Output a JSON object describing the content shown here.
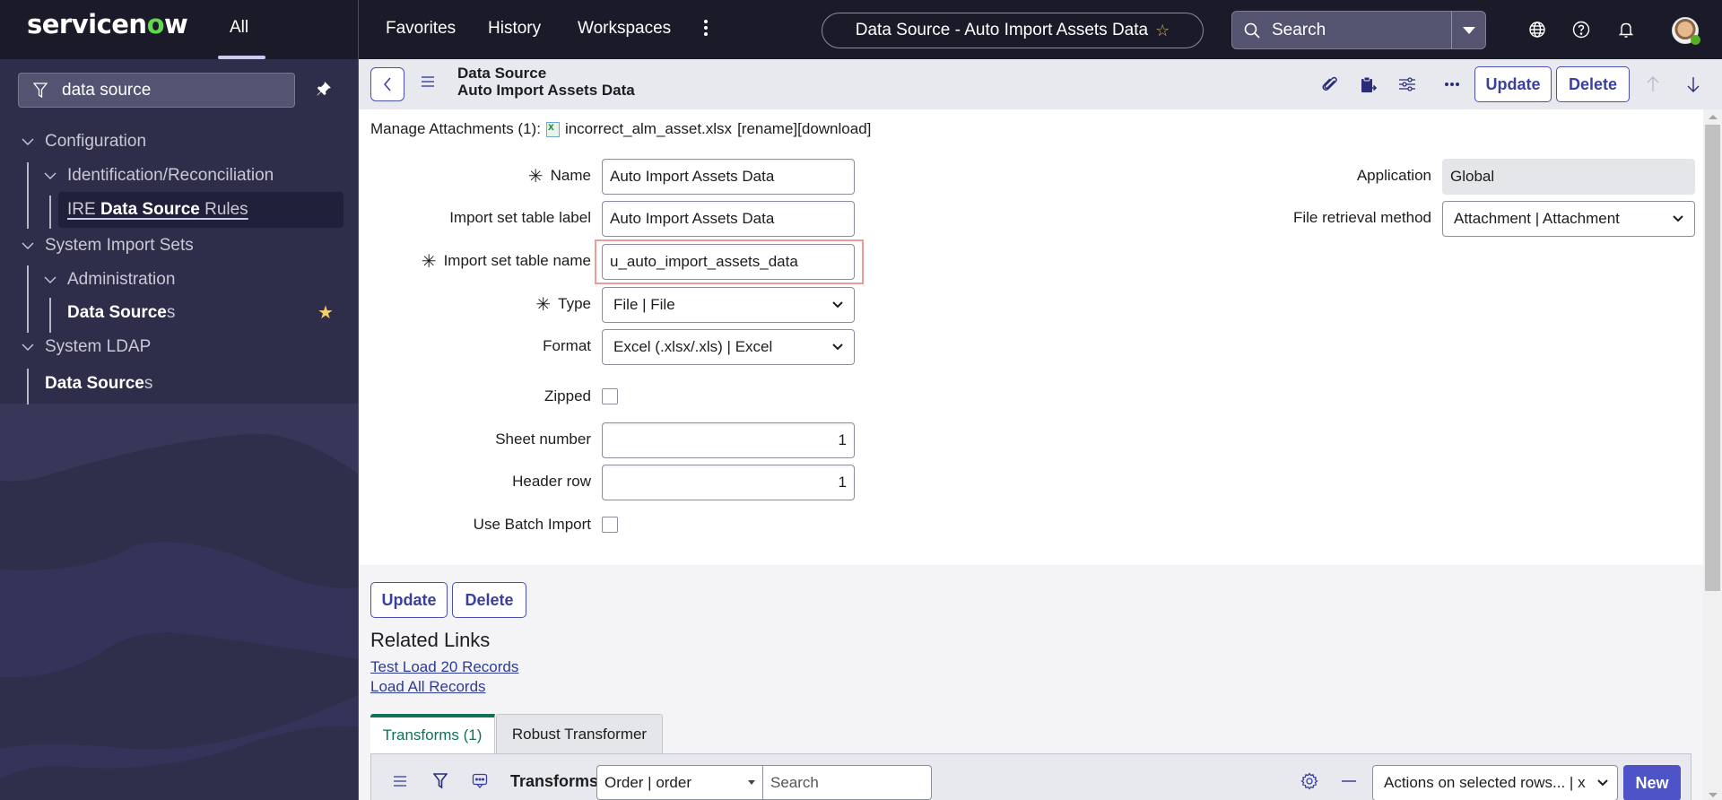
{
  "topbar": {
    "logo_main": "servicen",
    "logo_o": "o",
    "logo_end": "w",
    "all_tab": "All",
    "nav": [
      "Favorites",
      "History",
      "Workspaces"
    ],
    "more_icon": "vertical-ellipsis-icon",
    "record_title": "Data Source - Auto Import Assets Data",
    "search_placeholder": "Search",
    "icons": [
      "globe-icon",
      "help-icon",
      "bell-icon",
      "user-avatar"
    ]
  },
  "sidebar": {
    "filter_value": "data source",
    "items": [
      {
        "label": "Configuration",
        "level": 0,
        "expanded": true
      },
      {
        "label": "Identification/Reconciliation",
        "level": 1,
        "expanded": true
      },
      {
        "label_pre": "IRE ",
        "label_match": "Data Source",
        "label_post": " Rules",
        "level": 2,
        "active": true
      },
      {
        "label": "System Import Sets",
        "level": 0,
        "expanded": true
      },
      {
        "label": "Administration",
        "level": 1,
        "expanded": true
      },
      {
        "label_match": "Data Source",
        "label_post": "s",
        "level": 2,
        "favorite": true
      },
      {
        "label": "System LDAP",
        "level": 0,
        "expanded": true
      },
      {
        "label_match": "Data Source",
        "label_post": "s",
        "level": 1
      }
    ]
  },
  "form_header": {
    "record_type": "Data Source",
    "record_name": "Auto Import Assets Data",
    "update_label": "Update",
    "delete_label": "Delete"
  },
  "attachments": {
    "label": "Manage Attachments (1):",
    "file": "incorrect_alm_asset.xlsx",
    "actions": "[rename][download]"
  },
  "form": {
    "name": {
      "label": "Name",
      "value": "Auto Import Assets Data",
      "required": true
    },
    "import_label": {
      "label": "Import set table label",
      "value": "Auto Import Assets Data"
    },
    "import_name": {
      "label": "Import set table name",
      "value": "u_auto_import_assets_data",
      "required": true
    },
    "type": {
      "label": "Type",
      "value": "File | File",
      "required": true
    },
    "format": {
      "label": "Format",
      "value": "Excel (.xlsx/.xls) | Excel"
    },
    "zipped": {
      "label": "Zipped",
      "checked": false
    },
    "sheet_number": {
      "label": "Sheet number",
      "value": "1"
    },
    "header_row": {
      "label": "Header row",
      "value": "1"
    },
    "batch_import": {
      "label": "Use Batch Import",
      "checked": false
    },
    "application": {
      "label": "Application",
      "value": "Global"
    },
    "file_retrieval": {
      "label": "File retrieval method",
      "value": "Attachment | Attachment"
    }
  },
  "bottom": {
    "update_label": "Update",
    "delete_label": "Delete",
    "related_links_title": "Related Links",
    "links": [
      "Test Load 20 Records",
      "Load All Records"
    ]
  },
  "related_list": {
    "tabs": [
      "Transforms (1)",
      "Robust Transformer"
    ],
    "active_tab": 0,
    "title": "Transforms",
    "sort_field": "Order | order",
    "search_placeholder": "Search",
    "actions_select": "Actions on selected rows... | x",
    "new_label": "New"
  },
  "colors": {
    "topbar_bg": "#1b1a29",
    "sidebar_bg": "#2e2e4a",
    "accent": "#4e54c8",
    "active_tab": "#0f7257",
    "highlight_border": "#f29a9a",
    "favorite_star": "#f7cd6a",
    "logo_green": "#62d84e"
  }
}
